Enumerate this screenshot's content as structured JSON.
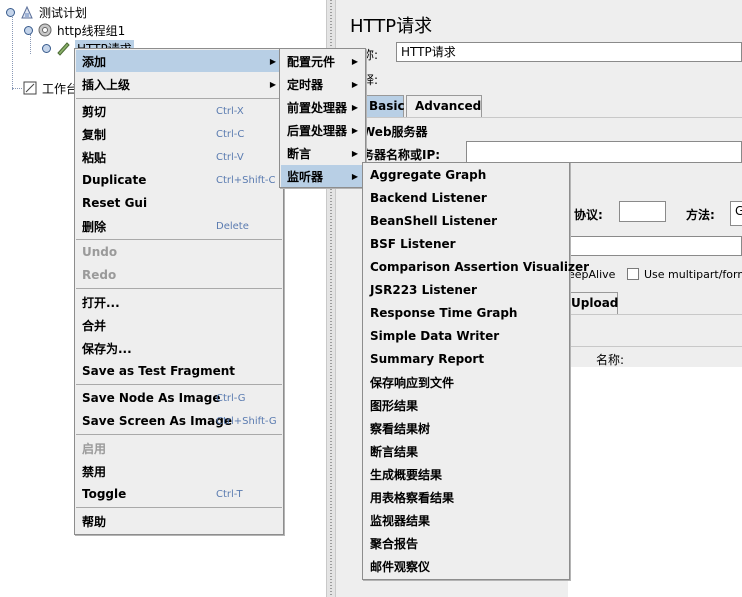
{
  "tree": {
    "items": [
      {
        "label": "测试计划",
        "icon": "test-plan-icon"
      },
      {
        "label": "http线程组1",
        "icon": "thread-group-gear-icon"
      },
      {
        "label": "HTTP请求",
        "icon": "sampler-pen-icon"
      },
      {
        "label": "工作台",
        "icon": "workbench-icon"
      }
    ]
  },
  "right": {
    "title": "HTTP请求",
    "name_label": "称:",
    "name_value": "HTTP请求",
    "comment_label": "释:",
    "tabs": [
      {
        "label": "Basic",
        "active": true
      },
      {
        "label": "Advanced",
        "active": false
      }
    ],
    "section_web_server": "Web服务器",
    "server_label": "务器名称或IP:",
    "protocol_label": "协议:",
    "method_label": "方法:",
    "method_value": "G",
    "keepalive_label": "eepAlive",
    "multipart_label": "Use multipart/form-da",
    "upload_tab": "Upload",
    "name_col_label": "名称:"
  },
  "context_menu": {
    "items": [
      {
        "label": "添加",
        "accel": "",
        "submenu": true,
        "highlighted": true,
        "disabled": false
      },
      {
        "label": "插入上级",
        "accel": "",
        "submenu": true,
        "highlighted": false,
        "disabled": false
      },
      {
        "sep": true
      },
      {
        "label": "剪切",
        "accel": "Ctrl-X"
      },
      {
        "label": "复制",
        "accel": "Ctrl-C"
      },
      {
        "label": "粘贴",
        "accel": "Ctrl-V"
      },
      {
        "label": "Duplicate",
        "accel": "Ctrl+Shift-C"
      },
      {
        "label": "Reset Gui",
        "accel": ""
      },
      {
        "label": "删除",
        "accel": "Delete"
      },
      {
        "sep": true
      },
      {
        "label": "Undo",
        "accel": "",
        "disabled": true
      },
      {
        "label": "Redo",
        "accel": "",
        "disabled": true
      },
      {
        "sep": true
      },
      {
        "label": "打开...",
        "accel": ""
      },
      {
        "label": "合并",
        "accel": ""
      },
      {
        "label": "保存为...",
        "accel": ""
      },
      {
        "label": "Save as Test Fragment",
        "accel": ""
      },
      {
        "sep": true
      },
      {
        "label": "Save Node As Image",
        "accel": "Ctrl-G"
      },
      {
        "label": "Save Screen As Image",
        "accel": "Ctrl+Shift-G"
      },
      {
        "sep": true
      },
      {
        "label": "启用",
        "accel": "",
        "disabled": true
      },
      {
        "label": "禁用",
        "accel": ""
      },
      {
        "label": "Toggle",
        "accel": "Ctrl-T"
      },
      {
        "sep": true
      },
      {
        "label": "帮助",
        "accel": ""
      }
    ]
  },
  "add_submenu": {
    "items": [
      {
        "label": "配置元件",
        "highlighted": false
      },
      {
        "label": "定时器",
        "highlighted": false
      },
      {
        "label": "前置处理器",
        "highlighted": false
      },
      {
        "label": "后置处理器",
        "highlighted": false
      },
      {
        "label": "断言",
        "highlighted": false
      },
      {
        "label": "监听器",
        "highlighted": true
      }
    ]
  },
  "listener_submenu": {
    "items": [
      "Aggregate Graph",
      "Backend Listener",
      "BeanShell Listener",
      "BSF Listener",
      "Comparison Assertion Visualizer",
      "JSR223 Listener",
      "Response Time Graph",
      "Simple Data Writer",
      "Summary Report",
      "保存响应到文件",
      "图形结果",
      "察看结果树",
      "断言结果",
      "生成概要结果",
      "用表格察看结果",
      "监视器结果",
      "聚合报告",
      "邮件观察仪"
    ]
  },
  "colors": {
    "highlight": "#b8cfe5",
    "menu_bg": "#eeeeee",
    "accel": "#5a7bb0"
  }
}
